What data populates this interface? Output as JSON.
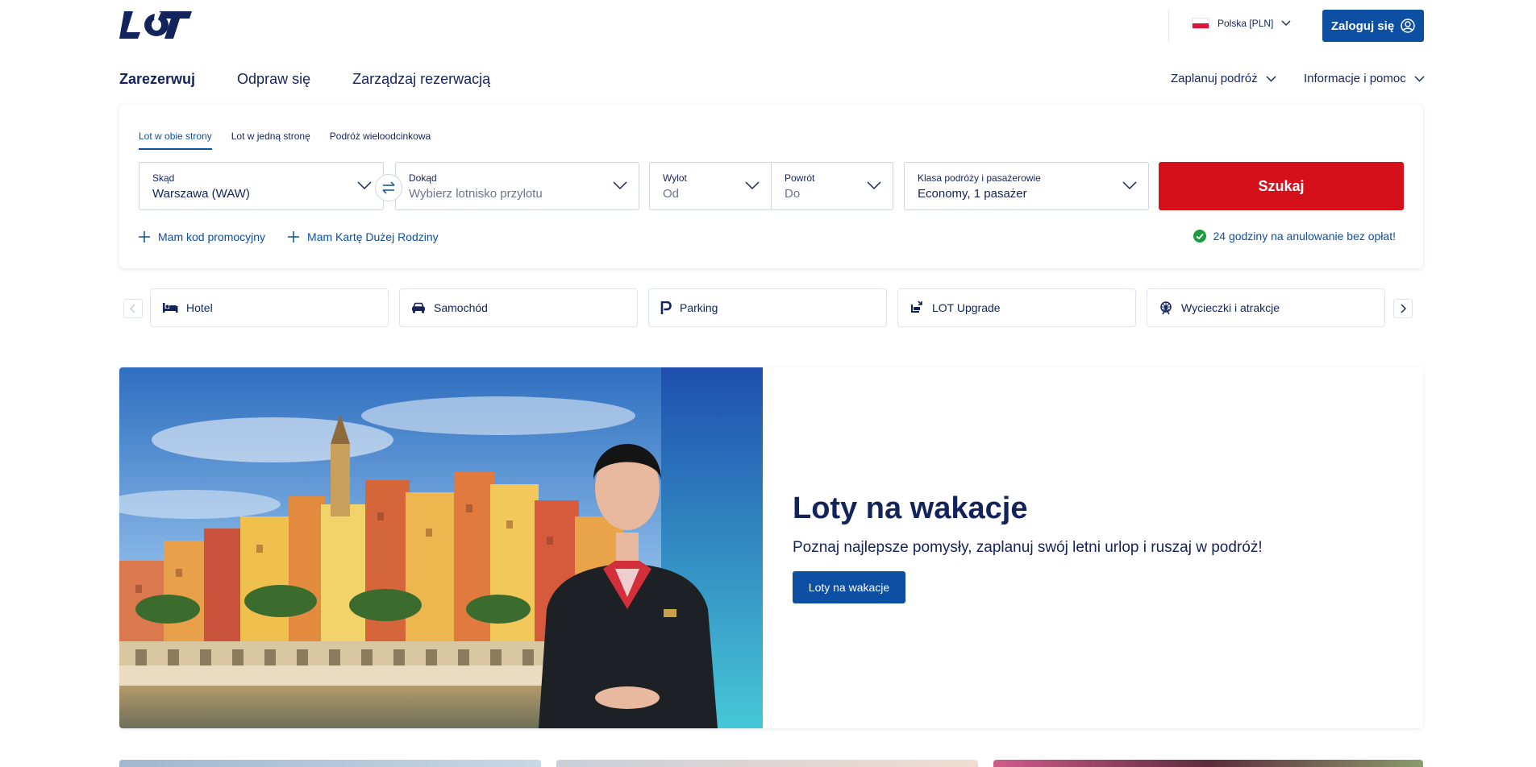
{
  "header": {
    "logo_text": "LOT",
    "language": "Polska [PLN]",
    "login_label": "Zaloguj się"
  },
  "nav": {
    "main": [
      {
        "label": "Zarezerwuj"
      },
      {
        "label": "Odpraw się"
      },
      {
        "label": "Zarządzaj rezerwacją"
      }
    ],
    "plan": "Zaplanuj podróż",
    "info": "Informacje i pomoc"
  },
  "booking": {
    "tabs": [
      {
        "label": "Lot w obie strony"
      },
      {
        "label": "Lot w jedną stronę"
      },
      {
        "label": "Podróż wieloodcinkowa"
      }
    ],
    "from": {
      "label": "Skąd",
      "value": "Warszawa (WAW)"
    },
    "to": {
      "label": "Dokąd",
      "placeholder": "Wybierz lotnisko przylotu"
    },
    "depart": {
      "label": "Wylot",
      "placeholder": "Od"
    },
    "return": {
      "label": "Powrót",
      "placeholder": "Do"
    },
    "cabin": {
      "label": "Klasa podróży i pasażerowie",
      "value": "Economy, 1 pasażer"
    },
    "search_label": "Szukaj",
    "promo_code": "Mam kod promocyjny",
    "family_card": "Mam Kartę Dużej Rodziny",
    "free_cancel": "24 godziny na anulowanie bez opłat!"
  },
  "services": [
    {
      "label": "Hotel",
      "icon": "bed-icon"
    },
    {
      "label": "Samochód",
      "icon": "car-icon"
    },
    {
      "label": "Parking",
      "icon": "parking-icon"
    },
    {
      "label": "LOT Upgrade",
      "icon": "upgrade-seat-icon"
    },
    {
      "label": "Wycieczki i atrakcje",
      "icon": "ferris-wheel-icon"
    }
  ],
  "hero": {
    "title": "Loty na wakacje",
    "subtitle": "Poznaj najlepsze pomysły, zaplanuj swój letni urlop i ruszaj w podróż!",
    "button": "Loty na wakacje"
  },
  "colors": {
    "primary": "#0d4fa3",
    "navy": "#13235b",
    "search_red": "#d6101b",
    "success_green": "#1e9b3c"
  }
}
